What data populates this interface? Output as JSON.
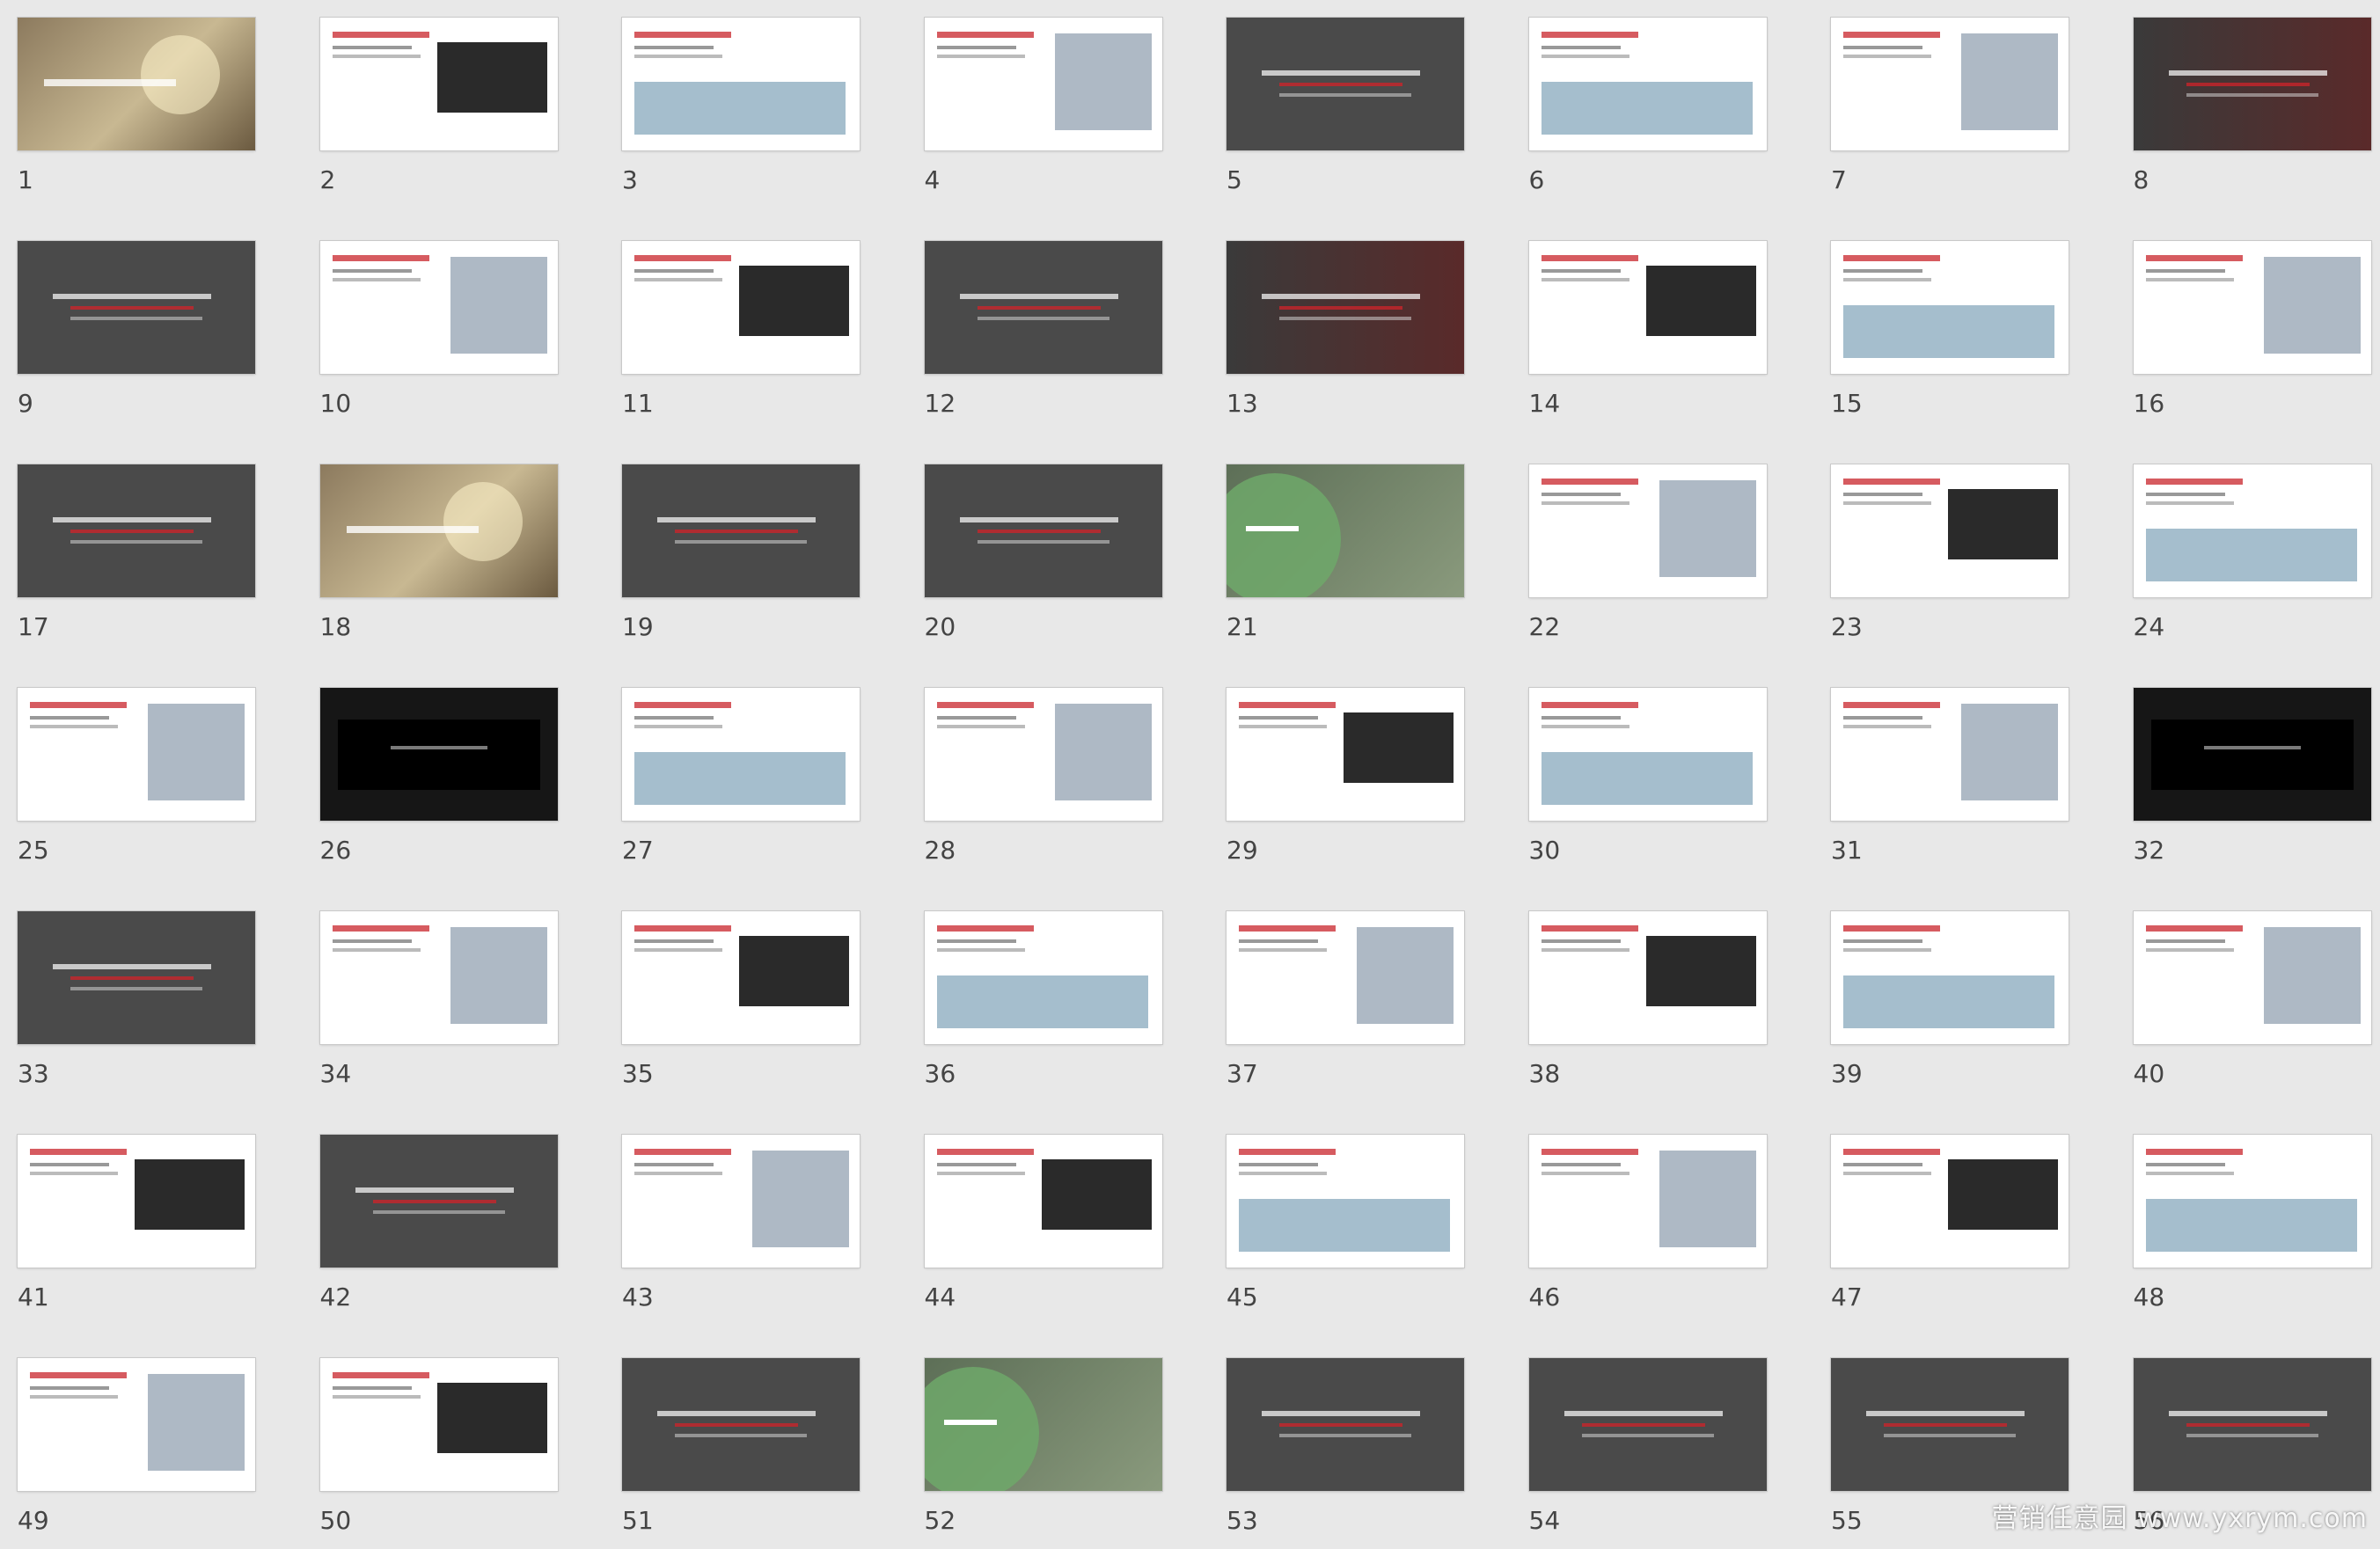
{
  "watermark": "营销任意园 www.yxrym.com",
  "colors": {
    "grid_bg": "#e8e8e8",
    "accent_green": "#6fa86a",
    "accent_red": "#c8242b",
    "text": "#444444"
  },
  "slides": [
    {
      "num": "1",
      "style": "photo"
    },
    {
      "num": "2",
      "style": "white"
    },
    {
      "num": "3",
      "style": "white"
    },
    {
      "num": "4",
      "style": "white"
    },
    {
      "num": "5",
      "style": "dark"
    },
    {
      "num": "6",
      "style": "white"
    },
    {
      "num": "7",
      "style": "white"
    },
    {
      "num": "8",
      "style": "redblack"
    },
    {
      "num": "9",
      "style": "dark"
    },
    {
      "num": "10",
      "style": "white"
    },
    {
      "num": "11",
      "style": "white"
    },
    {
      "num": "12",
      "style": "dark"
    },
    {
      "num": "13",
      "style": "redblack"
    },
    {
      "num": "14",
      "style": "white"
    },
    {
      "num": "15",
      "style": "white"
    },
    {
      "num": "16",
      "style": "white"
    },
    {
      "num": "17",
      "style": "dark"
    },
    {
      "num": "18",
      "style": "photo"
    },
    {
      "num": "19",
      "style": "dark"
    },
    {
      "num": "20",
      "style": "dark"
    },
    {
      "num": "21",
      "style": "green"
    },
    {
      "num": "22",
      "style": "white"
    },
    {
      "num": "23",
      "style": "white"
    },
    {
      "num": "24",
      "style": "white"
    },
    {
      "num": "25",
      "style": "white"
    },
    {
      "num": "26",
      "style": "black"
    },
    {
      "num": "27",
      "style": "white"
    },
    {
      "num": "28",
      "style": "white"
    },
    {
      "num": "29",
      "style": "white"
    },
    {
      "num": "30",
      "style": "white"
    },
    {
      "num": "31",
      "style": "white"
    },
    {
      "num": "32",
      "style": "black"
    },
    {
      "num": "33",
      "style": "dark"
    },
    {
      "num": "34",
      "style": "white"
    },
    {
      "num": "35",
      "style": "white"
    },
    {
      "num": "36",
      "style": "white"
    },
    {
      "num": "37",
      "style": "white"
    },
    {
      "num": "38",
      "style": "white"
    },
    {
      "num": "39",
      "style": "white"
    },
    {
      "num": "40",
      "style": "white"
    },
    {
      "num": "41",
      "style": "white"
    },
    {
      "num": "42",
      "style": "dark"
    },
    {
      "num": "43",
      "style": "white"
    },
    {
      "num": "44",
      "style": "white"
    },
    {
      "num": "45",
      "style": "white"
    },
    {
      "num": "46",
      "style": "white"
    },
    {
      "num": "47",
      "style": "white"
    },
    {
      "num": "48",
      "style": "white"
    },
    {
      "num": "49",
      "style": "white"
    },
    {
      "num": "50",
      "style": "white"
    },
    {
      "num": "51",
      "style": "dark"
    },
    {
      "num": "52",
      "style": "green"
    },
    {
      "num": "53",
      "style": "dark"
    },
    {
      "num": "54",
      "style": "dark"
    },
    {
      "num": "55",
      "style": "dark"
    },
    {
      "num": "56",
      "style": "dark"
    }
  ]
}
